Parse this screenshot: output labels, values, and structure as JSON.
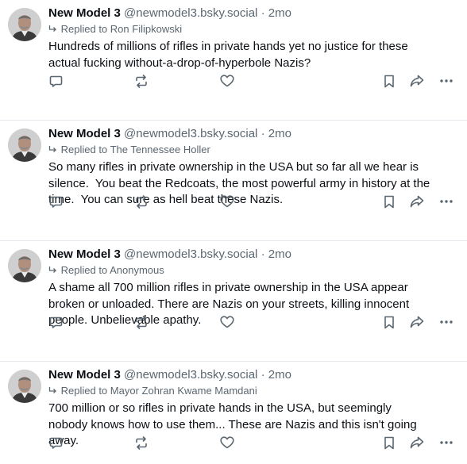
{
  "posts": [
    {
      "author": "New Model 3",
      "handle": "@newmodel3.bsky.social",
      "separator": "·",
      "time": "2mo",
      "reply_prefix": "Replied to",
      "reply_to": "Ron Filipkowski",
      "text": "Hundreds of millions of rifles in private hands yet no justice for these\nactual fucking without-a-drop-of-hyperbole Nazis?"
    },
    {
      "author": "New Model 3",
      "handle": "@newmodel3.bsky.social",
      "separator": "·",
      "time": "2mo",
      "reply_prefix": "Replied to",
      "reply_to": "The Tennessee Holler",
      "text": "So many rifles in private ownership in the USA but so far all we hear is\nsilence.  You beat the Redcoats, the most powerful army in history at the\ntime.  You can sure as hell beat these Nazis."
    },
    {
      "author": "New Model 3",
      "handle": "@newmodel3.bsky.social",
      "separator": "·",
      "time": "2mo",
      "reply_prefix": "Replied to",
      "reply_to": "Anonymous",
      "text": "A shame all 700 million rifles in private ownership in the USA appear\nbroken or unloaded. There are Nazis on your streets, killing innocent\npeople. Unbelievable apathy."
    },
    {
      "author": "New Model 3",
      "handle": "@newmodel3.bsky.social",
      "separator": "·",
      "time": "2mo",
      "reply_prefix": "Replied to",
      "reply_to": "Mayor Zohran Kwame Mamdani",
      "text": "700 million or so rifles in private hands in the USA, but seemingly\nnobody knows how to use them... These are Nazis and this isn't going\naway."
    }
  ],
  "icons": {
    "reply": "reply-bubble-icon",
    "repost": "repost-icon",
    "like": "heart-icon",
    "bookmark": "bookmark-icon",
    "share": "share-arrow-icon",
    "more": "more-dots-icon"
  },
  "colors": {
    "icon": "#5b6770",
    "text": "#0b0f14",
    "muted": "#5b6770",
    "divider": "#e3e7eb"
  }
}
